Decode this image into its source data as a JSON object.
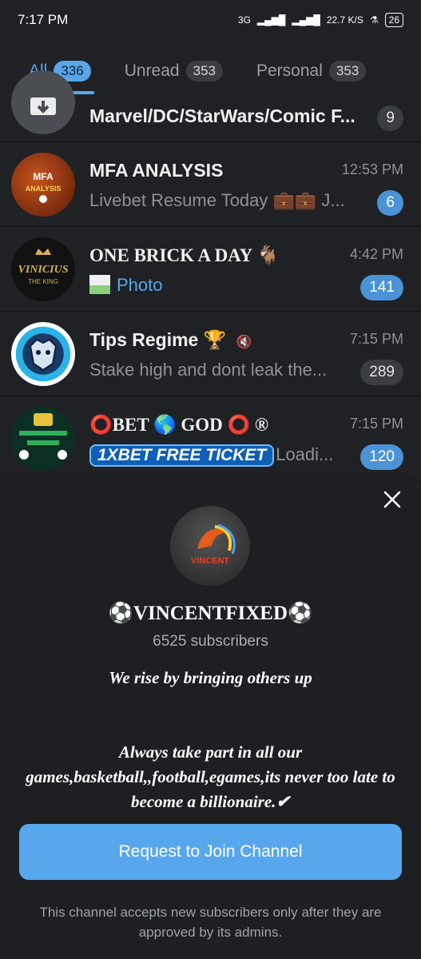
{
  "status_bar": {
    "time": "7:17 PM",
    "network": "3G",
    "speed": "22.7 K/S",
    "battery": "26"
  },
  "tabs": [
    {
      "label": "All",
      "count": "336"
    },
    {
      "label": "Unread",
      "count": "353"
    },
    {
      "label": "Personal",
      "count": "353"
    }
  ],
  "chats": [
    {
      "title": "Marvel/DC/StarWars/Comic F...",
      "time": "",
      "preview": "",
      "badge": "9"
    },
    {
      "title": "MFA ANALYSIS",
      "time": "12:53 PM",
      "preview": "Livebet Resume Today 💼💼 J...",
      "badge": "6"
    },
    {
      "title": "ONE BRICK A DAY 🐐",
      "time": "4:42 PM",
      "preview": "Photo",
      "badge": "141"
    },
    {
      "title": "Tips Regime 🏆",
      "time": "7:15 PM",
      "preview": "Stake high and dont leak the...",
      "badge": "289"
    },
    {
      "title": "⭕BET 🌎 GOD ⭕ ®",
      "time": "7:15 PM",
      "preview": "Loadi...",
      "badge": "120"
    }
  ],
  "sheet": {
    "channel_name": "⚽VINCENTFIXED⚽",
    "subscribers": "6525 subscribers",
    "description": "We rise by bringing others up\n\n\nAlways take part in all our games,basketball,,football,egames,its never too late to become a billionaire.✔",
    "join_label": "Request to Join Channel",
    "note": "This channel accepts new subscribers only after they are approved by its admins."
  },
  "avatar_labels": {
    "mfa": "MFA ANALYSIS",
    "vinicius": "VINICIUS THE KING",
    "xbet": "1XBET FREE TICKET",
    "vincent": "VINCENT"
  },
  "colors": {
    "accent": "#58a9ef",
    "badge_blue": "#4b93d6",
    "background": "#1f2124"
  }
}
